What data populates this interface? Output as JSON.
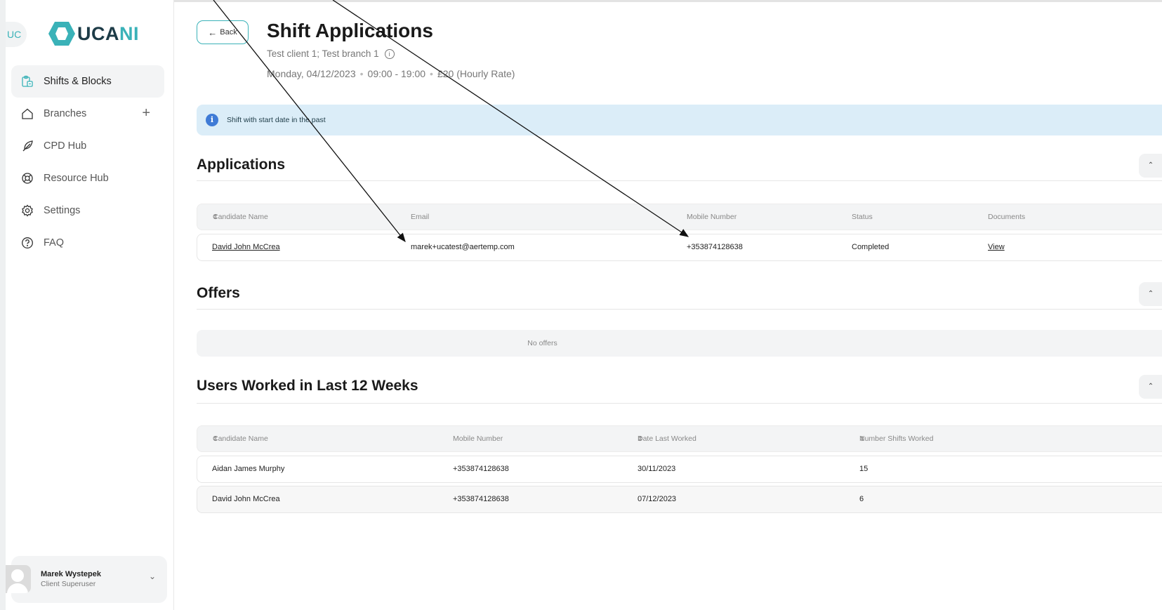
{
  "sidebar": {
    "badge": "UC",
    "logo": {
      "text_dark": "UCA",
      "text_teal": "NI"
    },
    "items": [
      {
        "label": "Shifts & Blocks",
        "icon": "shifts-icon",
        "active": true
      },
      {
        "label": "Branches",
        "icon": "home-icon",
        "has_add": true,
        "add_label": "+"
      },
      {
        "label": "CPD Hub",
        "icon": "feather-icon"
      },
      {
        "label": "Resource Hub",
        "icon": "lifebuoy-icon"
      },
      {
        "label": "Settings",
        "icon": "gear-icon"
      },
      {
        "label": "FAQ",
        "icon": "question-icon"
      }
    ],
    "user": {
      "name": "Marek Wystepek",
      "role": "Client Superuser",
      "chevron": "⌄"
    }
  },
  "header": {
    "back_label": "Back",
    "title": "Shift Applications",
    "subtitle": "Test client 1; Test branch 1",
    "date": "Monday, 04/12/2023",
    "time": "09:00 - 19:00",
    "rate": "£20 (Hourly Rate)"
  },
  "alert": {
    "text": "Shift with start date in the past",
    "icon": "info-icon"
  },
  "applications": {
    "title": "Applications",
    "columns": [
      "Candidate Name",
      "Email",
      "Mobile Number",
      "Status",
      "Documents"
    ],
    "rows": [
      {
        "name": "David John McCrea",
        "email": "marek+ucatest@aertemp.com",
        "mobile": "+353874128638",
        "status": "Completed",
        "documents": "View"
      }
    ]
  },
  "offers": {
    "title": "Offers",
    "empty": "No offers"
  },
  "worked": {
    "title": "Users Worked in Last 12 Weeks",
    "columns": [
      "Candidate Name",
      "Mobile Number",
      "Date Last Worked",
      "Number Shifts Worked"
    ],
    "rows": [
      {
        "name": "Aidan James Murphy",
        "mobile": "+353874128638",
        "date": "30/11/2023",
        "count": "15"
      },
      {
        "name": "David John McCrea",
        "mobile": "+353874128638",
        "date": "07/12/2023",
        "count": "6"
      }
    ]
  },
  "colors": {
    "accent": "#3ab2b8",
    "brand_dark": "#1d3b47",
    "alert_bg": "#dbedf8",
    "info_blue": "#3f7bd6"
  }
}
